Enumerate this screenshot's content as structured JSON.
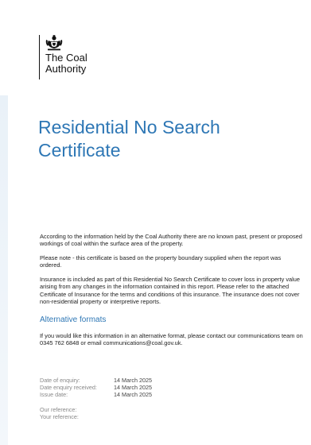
{
  "logo": {
    "line1": "The Coal",
    "line2": "Authority",
    "icon": "royal-crest-icon"
  },
  "title": {
    "line1": "Residential No Search",
    "line2": "Certificate"
  },
  "paragraphs": {
    "p1": "According to the information held by the Coal Authority there are no known past, present or proposed workings of coal within the surface area of the property.",
    "p2": "Please note - this certificate is based on the property boundary supplied when the report was ordered.",
    "p3": "Insurance is included as part of this Residential No Search Certificate to cover loss in property value arising from any changes in the information contained in this report.  Please refer to the attached Certificate of Insurance for the terms and conditions of this insurance.  The insurance does not cover non-residential property or interpretive reports.",
    "p4": "If you would like this information in an alternative format, please contact our communications team on 0345 762 6848 or email communications@coal.gov.uk."
  },
  "alt_formats_heading": "Alternative formats",
  "details": [
    {
      "label": "Date of enquiry:",
      "value": "14 March 2025"
    },
    {
      "label": "Date enquiry received:",
      "value": "14 March 2025"
    },
    {
      "label": "Issue date:",
      "value": "14 March 2025"
    }
  ],
  "references": {
    "ours": "Our reference:",
    "yours": "Your reference:"
  },
  "colors": {
    "accent": "#2e77b5",
    "muted": "#888888"
  }
}
